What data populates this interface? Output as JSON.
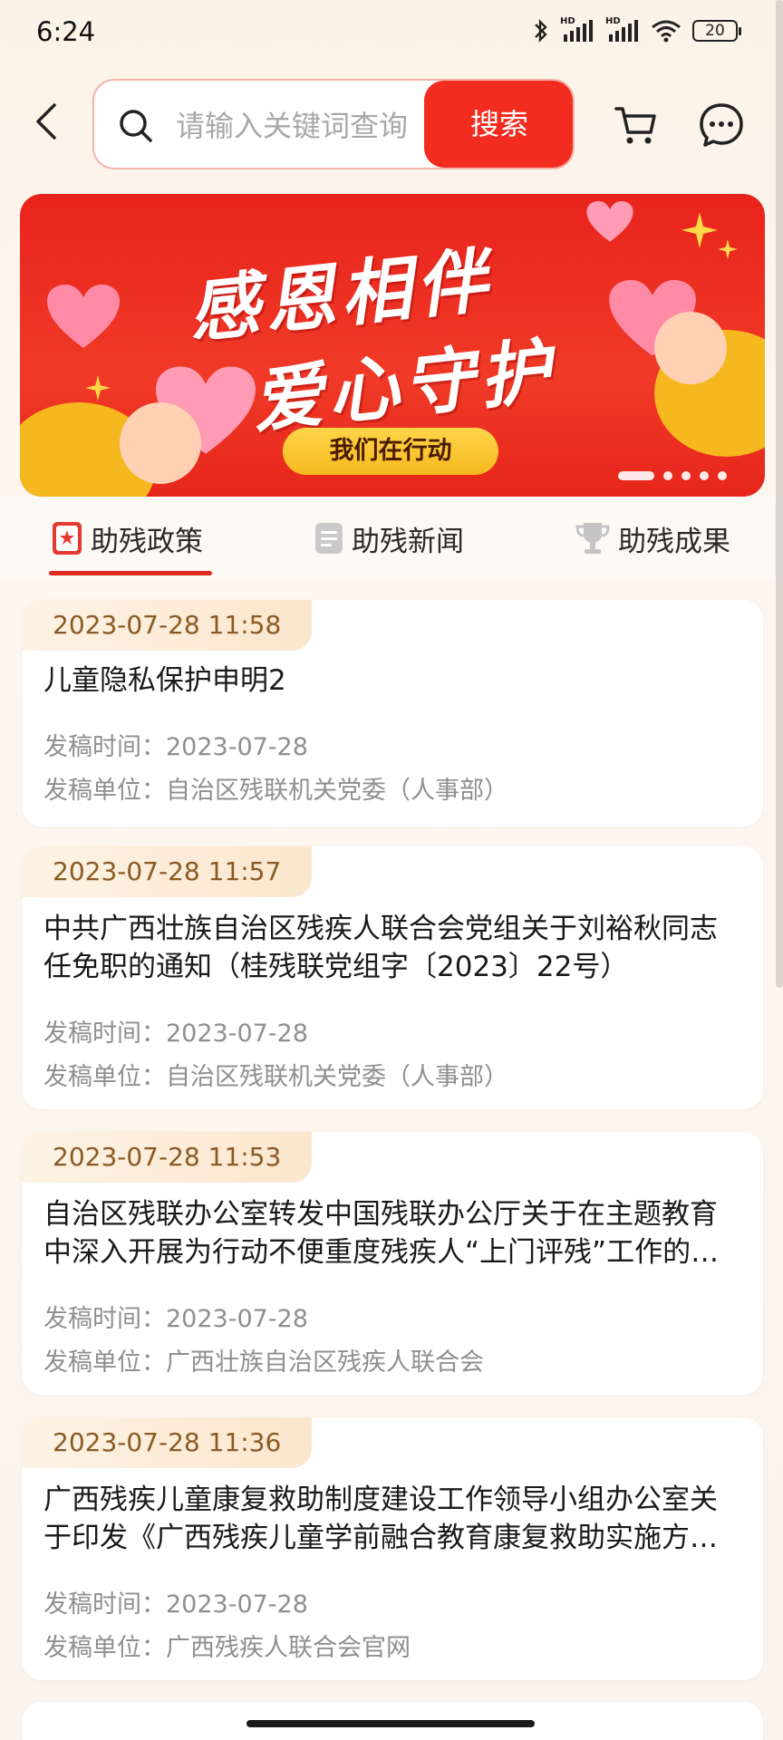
{
  "status_bar": {
    "time": "6:24",
    "battery": "20",
    "hd_label": "HD"
  },
  "search": {
    "placeholder": "请输入关键词查询",
    "button_label": "搜索"
  },
  "banner": {
    "title_line1": "感恩相伴",
    "title_line2": "爱心守护",
    "pill_text": "我们在行动",
    "dots_total": 5,
    "dots_active": 0,
    "colors": {
      "bg": "#e8231c",
      "pill": "#ffd54a"
    }
  },
  "tabs": [
    {
      "label": "助残政策",
      "icon": "policy-badge-icon",
      "active": true
    },
    {
      "label": "助残新闻",
      "icon": "news-doc-icon",
      "active": false
    },
    {
      "label": "助残成果",
      "icon": "trophy-icon",
      "active": false
    }
  ],
  "articles": [
    {
      "tag": "2023-07-28 11:58",
      "title": "儿童隐私保护申明2",
      "time_label": "发稿时间：",
      "time_value": "2023-07-28",
      "unit_label": "发稿单位：",
      "unit_value": "自治区残联机关党委（人事部）"
    },
    {
      "tag": "2023-07-28 11:57",
      "title": "中共广西壮族自治区残疾人联合会党组关于刘裕秋同志任免职的通知（桂残联党组字〔2023〕22号）",
      "time_label": "发稿时间：",
      "time_value": "2023-07-28",
      "unit_label": "发稿单位：",
      "unit_value": "自治区残联机关党委（人事部）"
    },
    {
      "tag": "2023-07-28 11:53",
      "title": "自治区残联办公室转发中国残联办公厅关于在主题教育中深入开展为行动不便重度残疾人“上门评残”工作的通知",
      "time_label": "发稿时间：",
      "time_value": "2023-07-28",
      "unit_label": "发稿单位：",
      "unit_value": "广西壮族自治区残疾人联合会"
    },
    {
      "tag": "2023-07-28 11:36",
      "title": "广西残疾儿童康复救助制度建设工作领导小组办公室关于印发《广西残疾儿童学前融合教育康复救助实施方案》的通知",
      "time_label": "发稿时间：",
      "time_value": "2023-07-28",
      "unit_label": "发稿单位：",
      "unit_value": "广西残疾人联合会官网"
    }
  ],
  "colors": {
    "accent": "#f22c1f",
    "tag_text": "#8a5a24",
    "meta_text": "#8f8f8f"
  }
}
